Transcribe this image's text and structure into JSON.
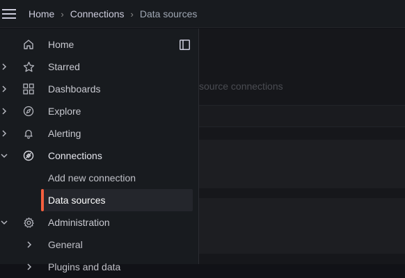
{
  "breadcrumb": {
    "items": [
      "Home",
      "Connections",
      "Data sources"
    ]
  },
  "main": {
    "faded_text": "source connections"
  },
  "sidebar": {
    "items": [
      {
        "label": "Home",
        "icon": "home-icon"
      },
      {
        "label": "Starred",
        "icon": "star-icon"
      },
      {
        "label": "Dashboards",
        "icon": "apps-icon"
      },
      {
        "label": "Explore",
        "icon": "compass-icon"
      },
      {
        "label": "Alerting",
        "icon": "bell-icon"
      },
      {
        "label": "Connections",
        "icon": "plug-icon"
      },
      {
        "label": "Add new connection"
      },
      {
        "label": "Data sources"
      },
      {
        "label": "Administration",
        "icon": "cog-icon"
      },
      {
        "label": "General"
      },
      {
        "label": "Plugins and data"
      }
    ]
  },
  "colors": {
    "accent": "#f55f3e",
    "topbar": "#181b1f",
    "sidebar": "#181b1f",
    "main": "#16171b"
  }
}
